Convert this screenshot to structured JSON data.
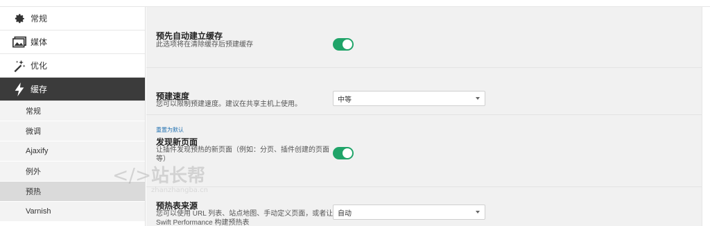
{
  "sidebar": {
    "items": [
      {
        "label": "常规",
        "icon": "gear-icon"
      },
      {
        "label": "媒体",
        "icon": "image-icon"
      },
      {
        "label": "优化",
        "icon": "magic-wand-icon"
      },
      {
        "label": "缓存",
        "icon": "lightning-icon"
      }
    ],
    "subitems": [
      "常规",
      "微调",
      "Ajaxify",
      "例外",
      "预热",
      "Varnish"
    ],
    "selected_subitem": "预热"
  },
  "settings": {
    "auto_build": {
      "title": "预先自动建立缓存",
      "desc": "此选项将在清除缓存后预建缓存",
      "enabled": true
    },
    "build_speed": {
      "title": "预建速度",
      "desc": "您可以限制预建速度。建议在共享主机上使用。",
      "value": "中等"
    },
    "discover_pages": {
      "reset": "重置为默认",
      "title": "发现新页面",
      "desc_line1": "让插件发现预热的新页面（例如：分页、插件创建的页面",
      "desc_line2": "等）",
      "enabled": true
    },
    "warmup_source": {
      "title": "预热表来源",
      "desc_line1": "您可以使用 URL 列表、站点地图、手动定义页面，或者让",
      "desc_line2": "Swift Performance 构建预热表",
      "value": "自动"
    }
  },
  "watermark": {
    "text": "站长帮",
    "sub": "zhanzhangba.cn"
  },
  "colors": {
    "toggle_on": "#20a469",
    "active_nav": "#3b3b3b",
    "link": "#2271b1"
  }
}
